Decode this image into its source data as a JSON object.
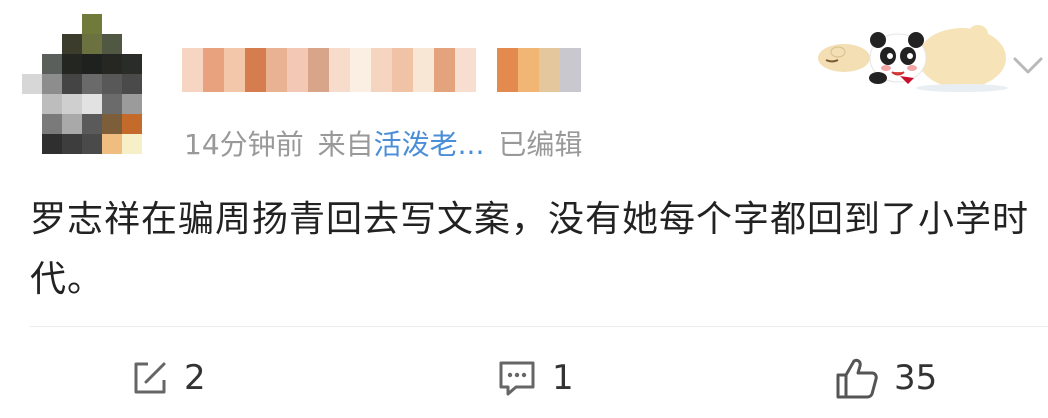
{
  "comment": {
    "meta": {
      "time": "14分钟前",
      "from_prefix": "来自",
      "from_source": "活泼老...",
      "edited": "已编辑"
    },
    "text": "罗志祥在骗周扬青回去写文案，没有她每个字都回到了小学时代。"
  },
  "actions": {
    "repost_count": "2",
    "comment_count": "1",
    "like_count": "35"
  },
  "icons": {
    "badge": "panda-sticker-icon",
    "menu": "chevron-down-icon",
    "repost": "repost-icon",
    "comment": "comment-icon",
    "like": "thumb-up-icon"
  },
  "colors": {
    "meta_gray": "#999999",
    "link_blue": "#4a8ed8",
    "text": "#222222",
    "divider": "#ececec"
  }
}
